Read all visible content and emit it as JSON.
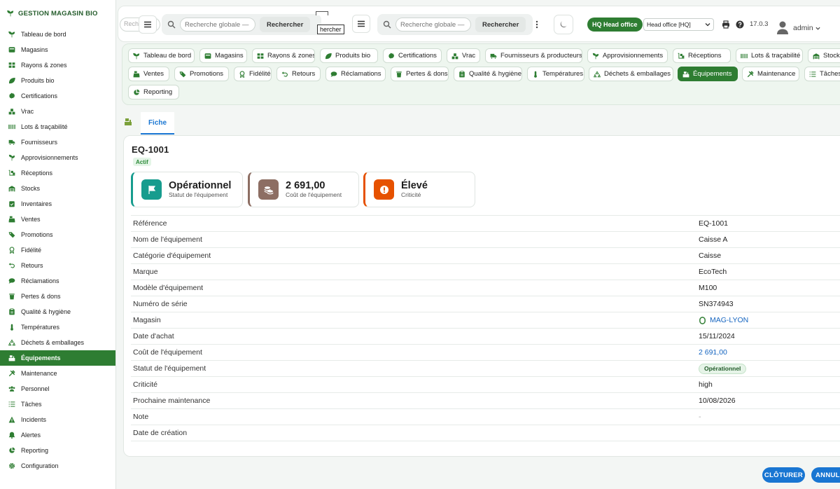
{
  "app": {
    "brand": "GESTION MAGASIN BIO"
  },
  "sidebar": {
    "items": [
      {
        "label": "Tableau de bord",
        "icon": "sprout-icon"
      },
      {
        "label": "Magasins",
        "icon": "store-icon"
      },
      {
        "label": "Rayons & zones",
        "icon": "grid-icon"
      },
      {
        "label": "Produits bio",
        "icon": "leaf-icon"
      },
      {
        "label": "Certifications",
        "icon": "certificate-icon"
      },
      {
        "label": "Vrac",
        "icon": "bulk-icon"
      },
      {
        "label": "Lots & traçabilité",
        "icon": "barcode-icon"
      },
      {
        "label": "Fournisseurs",
        "icon": "truck-icon"
      },
      {
        "label": "Approvisionnements",
        "icon": "seedling-icon"
      },
      {
        "label": "Réceptions",
        "icon": "dolly-icon"
      },
      {
        "label": "Stocks",
        "icon": "warehouse-icon"
      },
      {
        "label": "Inventaires",
        "icon": "clipboard-check-icon"
      },
      {
        "label": "Ventes",
        "icon": "cash-register-icon"
      },
      {
        "label": "Promotions",
        "icon": "tag-icon"
      },
      {
        "label": "Fidélité",
        "icon": "award-icon"
      },
      {
        "label": "Retours",
        "icon": "undo-icon"
      },
      {
        "label": "Réclamations",
        "icon": "comment-icon"
      },
      {
        "label": "Pertes & dons",
        "icon": "trash-icon"
      },
      {
        "label": "Qualité & hygiène",
        "icon": "clipboard-icon"
      },
      {
        "label": "Températures",
        "icon": "thermometer-icon"
      },
      {
        "label": "Déchets & emballages",
        "icon": "recycle-icon"
      },
      {
        "label": "Équipements",
        "icon": "equipment-icon",
        "active": true
      },
      {
        "label": "Maintenance",
        "icon": "tools-icon"
      },
      {
        "label": "Personnel",
        "icon": "users-icon"
      },
      {
        "label": "Tâches",
        "icon": "list-icon"
      },
      {
        "label": "Incidents",
        "icon": "warning-icon"
      },
      {
        "label": "Alertes",
        "icon": "bell-icon"
      },
      {
        "label": "Reporting",
        "icon": "chart-pie-icon"
      },
      {
        "label": "Configuration",
        "icon": "gear-icon"
      }
    ]
  },
  "topbar": {
    "search_placeholder": "Recherche globale — c",
    "search_placeholder_cut": "Rech",
    "search_button": "Rechercher",
    "tooltip_text": "hercher",
    "hq_badge": "HQ Head office",
    "office_select": "Head office [HQ]",
    "version": "17.0.3",
    "user": "admin"
  },
  "modules": {
    "row1": [
      {
        "label": "Tableau de bord",
        "icon": "sprout-icon"
      },
      {
        "label": "Magasins",
        "icon": "store-icon"
      },
      {
        "label": "Rayons & zones",
        "icon": "grid-icon"
      },
      {
        "label": "Produits bio",
        "icon": "leaf-icon"
      },
      {
        "label": "Certifications",
        "icon": "certificate-icon"
      },
      {
        "label": "Vrac",
        "icon": "bulk-icon"
      },
      {
        "label": "Fournisseurs & producteurs",
        "icon": "truck-icon"
      },
      {
        "label": "Approvisionnements",
        "icon": "seedling-icon"
      },
      {
        "label": "Réceptions",
        "icon": "dolly-icon"
      },
      {
        "label": "Lots & traçabilité",
        "icon": "barcode-icon"
      },
      {
        "label": "Stock",
        "icon": "warehouse-icon"
      }
    ],
    "row2": [
      {
        "label": "Ventes",
        "icon": "cash-register-icon"
      },
      {
        "label": "Promotions",
        "icon": "tag-icon"
      },
      {
        "label": "Fidélité",
        "icon": "award-icon"
      },
      {
        "label": "Retours",
        "icon": "undo-icon"
      },
      {
        "label": "Réclamations",
        "icon": "comment-icon"
      },
      {
        "label": "Pertes & dons",
        "icon": "trash-icon"
      },
      {
        "label": "Qualité & hygiène",
        "icon": "clipboard-icon"
      },
      {
        "label": "Températures",
        "icon": "thermometer-icon"
      },
      {
        "label": "Déchets & emballages",
        "icon": "recycle-icon"
      },
      {
        "label": "Équipements",
        "icon": "equipment-icon",
        "active": true
      },
      {
        "label": "Maintenance",
        "icon": "tools-icon"
      },
      {
        "label": "Tâches",
        "icon": "list-icon"
      }
    ],
    "row3": [
      {
        "label": "Reporting",
        "icon": "chart-pie-icon"
      }
    ]
  },
  "tabs": {
    "active": "Fiche"
  },
  "record": {
    "title": "EQ-1001",
    "badge": "Actif",
    "kpis": [
      {
        "value": "Opérationnel",
        "label": "Statut de l'équipement",
        "icon": "flag-icon",
        "color": "#179c8e"
      },
      {
        "value": "2 691,00",
        "label": "Coût de l'équipement",
        "icon": "coins-icon",
        "color": "#8d6e63"
      },
      {
        "value": "Élevé",
        "label": "Criticité",
        "icon": "alert-icon",
        "color": "#e65100"
      }
    ],
    "fields": [
      {
        "label": "Référence",
        "value": "EQ-1001"
      },
      {
        "label": "Nom de l'équipement",
        "value": "Caisse A"
      },
      {
        "label": "Catégorie d'équipement",
        "value": "Caisse"
      },
      {
        "label": "Marque",
        "value": "EcoTech"
      },
      {
        "label": "Modèle d'équipement",
        "value": "M100"
      },
      {
        "label": "Numéro de série",
        "value": "SN374943"
      },
      {
        "label": "Magasin",
        "value": "MAG-LYON",
        "type": "link"
      },
      {
        "label": "Date d'achat",
        "value": "15/11/2024"
      },
      {
        "label": "Coût de l'équipement",
        "value": "2 691,00",
        "type": "money"
      },
      {
        "label": "Statut de l'équipement",
        "value": "Opérationnel",
        "type": "pill"
      },
      {
        "label": "Criticité",
        "value": "high"
      },
      {
        "label": "Prochaine maintenance",
        "value": "10/08/2026"
      },
      {
        "label": "Note",
        "value": "-",
        "type": "muted"
      },
      {
        "label": "Date de création",
        "value": ""
      }
    ]
  },
  "footer": {
    "close_button": "CLÔTURER",
    "cancel_button": "ANNULER"
  },
  "colors": {
    "primary": "#2e7d32",
    "accent": "#1976d2"
  }
}
